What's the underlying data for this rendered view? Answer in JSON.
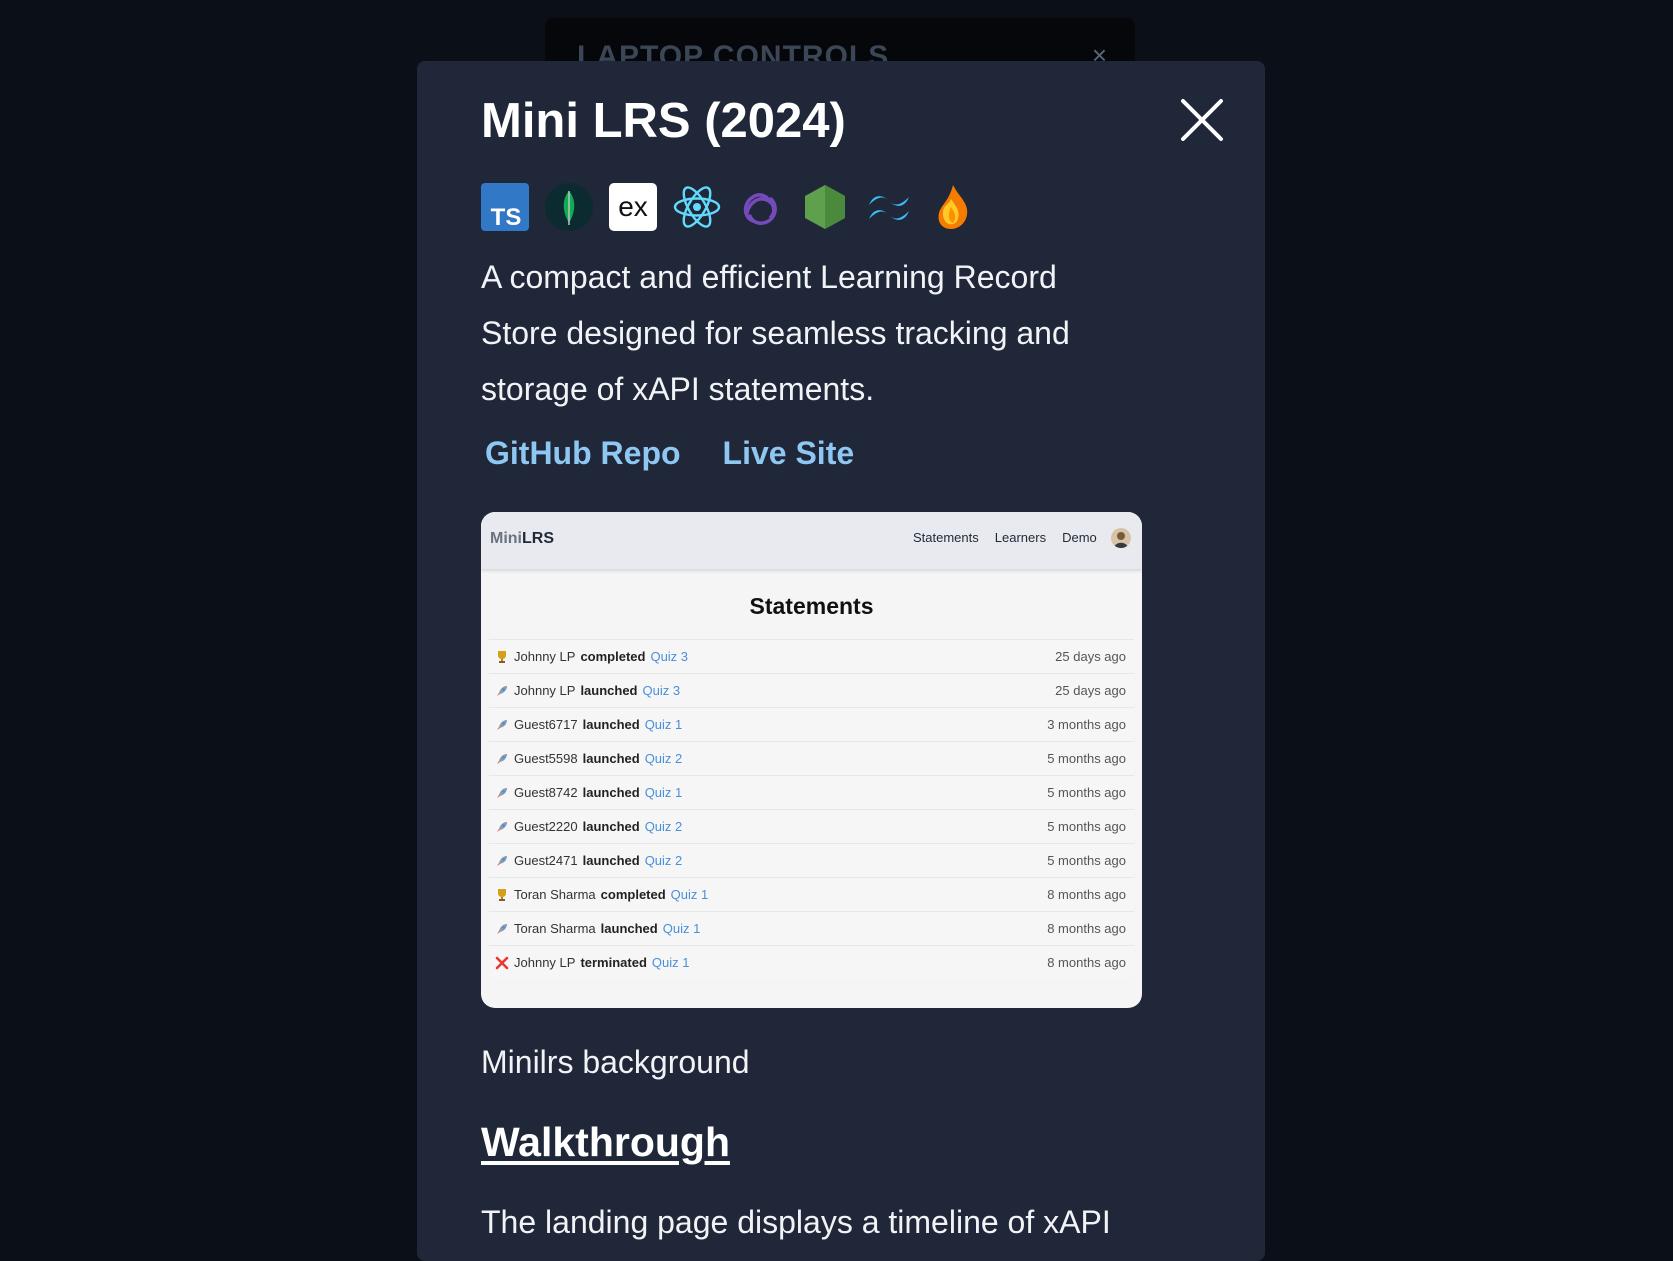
{
  "background_panel": {
    "title": "LAPTOP CONTROLS",
    "close_glyph": "×"
  },
  "modal": {
    "title": "Mini LRS (2024)",
    "close_icon": "close-icon",
    "tech_icons": [
      "typescript-icon",
      "mongodb-icon",
      "express-icon",
      "react-icon",
      "redux-icon",
      "nodejs-icon",
      "tailwind-icon",
      "firebase-icon"
    ],
    "description": "A compact and efficient Learning Record Store designed for seamless tracking and storage of xAPI statements.",
    "links": {
      "github": "GitHub Repo",
      "live": "Live Site"
    },
    "screenshot": {
      "brand_prefix": "Mini",
      "brand_suffix": "LRS",
      "nav": [
        "Statements",
        "Learners",
        "Demo"
      ],
      "heading": "Statements",
      "rows": [
        {
          "icon": "trophy-icon",
          "actor": "Johnny LP",
          "verb": "completed",
          "object": "Quiz 3",
          "time": "25 days ago"
        },
        {
          "icon": "rocket-icon",
          "actor": "Johnny LP",
          "verb": "launched",
          "object": "Quiz 3",
          "time": "25 days ago"
        },
        {
          "icon": "rocket-icon",
          "actor": "Guest6717",
          "verb": "launched",
          "object": "Quiz 1",
          "time": "3 months ago"
        },
        {
          "icon": "rocket-icon",
          "actor": "Guest5598",
          "verb": "launched",
          "object": "Quiz 2",
          "time": "5 months ago"
        },
        {
          "icon": "rocket-icon",
          "actor": "Guest8742",
          "verb": "launched",
          "object": "Quiz 1",
          "time": "5 months ago"
        },
        {
          "icon": "rocket-icon",
          "actor": "Guest2220",
          "verb": "launched",
          "object": "Quiz 2",
          "time": "5 months ago"
        },
        {
          "icon": "rocket-icon",
          "actor": "Guest2471",
          "verb": "launched",
          "object": "Quiz 2",
          "time": "5 months ago"
        },
        {
          "icon": "trophy-icon",
          "actor": "Toran Sharma",
          "verb": "completed",
          "object": "Quiz 1",
          "time": "8 months ago"
        },
        {
          "icon": "rocket-icon",
          "actor": "Toran Sharma",
          "verb": "launched",
          "object": "Quiz 1",
          "time": "8 months ago"
        },
        {
          "icon": "cross-icon",
          "actor": "Johnny LP",
          "verb": "terminated",
          "object": "Quiz 1",
          "time": "8 months ago"
        }
      ]
    },
    "caption": "Minilrs background",
    "walkthrough_heading": "Walkthrough",
    "landing_text": "The landing page displays a timeline of xAPI"
  },
  "colors": {
    "overlay": "#0b0f18",
    "modal": "#1f2738",
    "link": "#8ec7f2",
    "object_link": "#4a8fd9"
  }
}
